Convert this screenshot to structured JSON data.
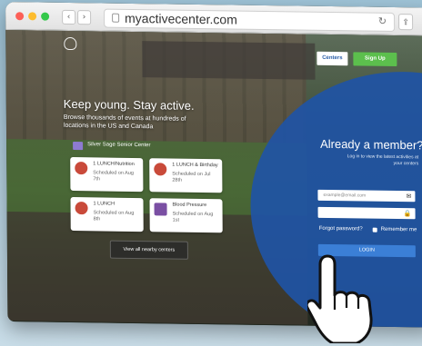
{
  "browser": {
    "url": "myactivecenter.com",
    "back_glyph": "‹",
    "forward_glyph": "›",
    "reload_glyph": "↻",
    "share_glyph": "⇪",
    "traffic_lights": [
      "#fc5f57",
      "#fdbc2e",
      "#34c84a"
    ]
  },
  "nav": {
    "centers_label": "Centers",
    "signup_label": "Sign Up"
  },
  "hero": {
    "headline": "Keep young. Stay active.",
    "subtext": "Browse thousands of events at hundreds of locations in the US and Canada"
  },
  "center": {
    "name": "Silver Sage Senior Center"
  },
  "events": [
    {
      "title": "1 LUNCH/Nutrition",
      "scheduled": "Scheduled on Aug 7th",
      "icon": "lunch-icon"
    },
    {
      "title": "1 LUNCH & Birthday",
      "scheduled": "Scheduled on Jul 28th",
      "icon": "lunch-icon"
    },
    {
      "title": "1 LUNCH",
      "scheduled": "Scheduled on Aug 8th",
      "icon": "lunch-icon"
    },
    {
      "title": "Blood Pressure",
      "scheduled": "Scheduled on Aug 1st",
      "icon": "blood-pressure-icon"
    }
  ],
  "view_all_label": "View all nearby centers",
  "login": {
    "title": "Already a member?",
    "subtitle": "Log in to view the latest activities at your centers",
    "email_placeholder": "example@email.com",
    "password_placeholder": "",
    "email_icon": "✉",
    "password_icon": "🔒",
    "forgot_label": "Forgot password?",
    "remember_label": "Remember me",
    "login_label": "LOGIN",
    "accent": "#1f54a5"
  }
}
